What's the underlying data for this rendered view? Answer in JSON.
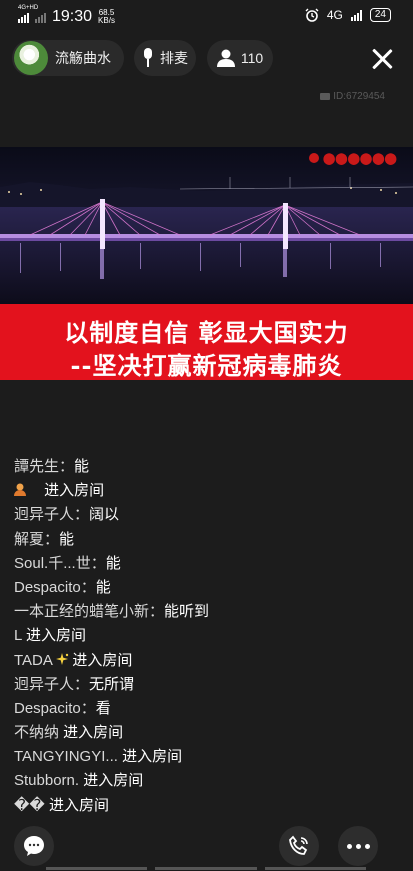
{
  "status_bar": {
    "network_tag": "4G+HD",
    "time": "19:30",
    "speed_value": "68.5",
    "speed_unit": "KB/s",
    "network_right": "4G",
    "battery": "24"
  },
  "header": {
    "room_name": "流觞曲水",
    "mic_label": "排麦",
    "online_count": "110"
  },
  "room_id": "ID:6729454",
  "banner": {
    "line1": "以制度自信  彰显大国实力",
    "line2": "--坚决打赢新冠病毒肺炎"
  },
  "chat": [
    {
      "name": "譚先生：",
      "text": "能"
    },
    {
      "name": "",
      "text": "进入房间",
      "icon": "user-avatar-icon"
    },
    {
      "name": "迥异子人：",
      "text": "阔以"
    },
    {
      "name": "解夏：",
      "text": "能"
    },
    {
      "name": "Soul.千...世：",
      "text": "能"
    },
    {
      "name": "Despacito：",
      "text": "能"
    },
    {
      "name": "一本正经的蜡笔小新：",
      "text": "能听到"
    },
    {
      "name": "L ",
      "text": "进入房间"
    },
    {
      "name": "TADA",
      "text": " 进入房间",
      "icon": "sparkle-icon"
    },
    {
      "name": "迥异子人：",
      "text": "无所谓"
    },
    {
      "name": "Despacito：",
      "text": "看"
    },
    {
      "name": "不纳纳 ",
      "text": "进入房间"
    },
    {
      "name": "TANGYINGYI... ",
      "text": "进入房间"
    },
    {
      "name": "Stubborn. ",
      "text": "进入房间"
    },
    {
      "name": "�� ",
      "text": "进入房间"
    }
  ],
  "colors": {
    "background": "#1c1c1c",
    "banner_red": "#e3121d",
    "pill": "#2a2a2a"
  }
}
